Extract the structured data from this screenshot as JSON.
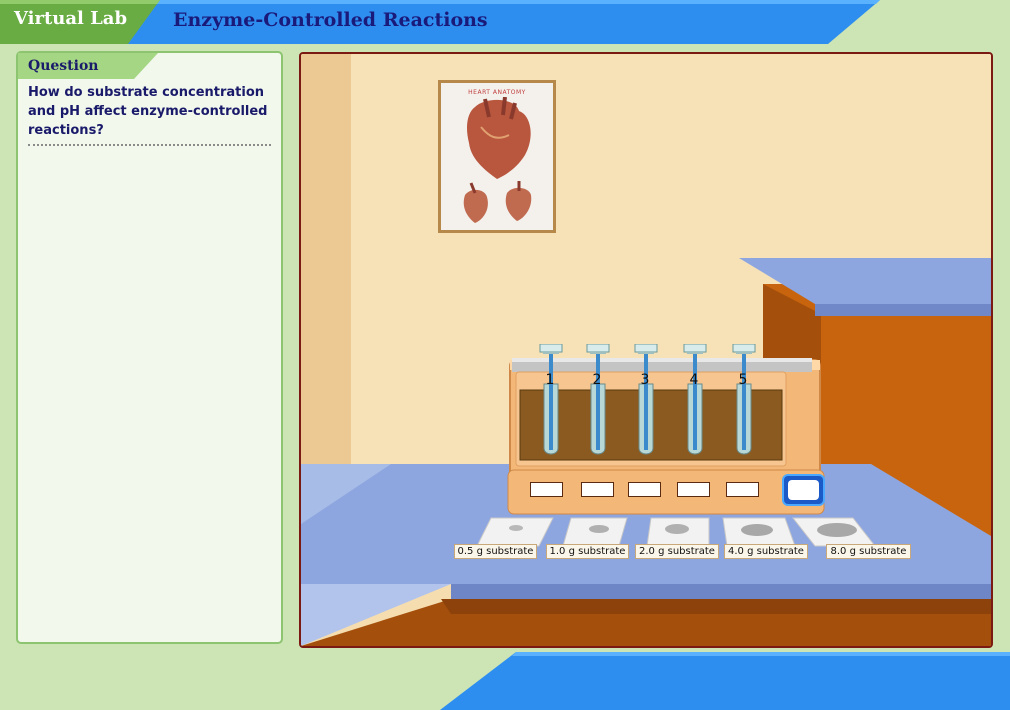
{
  "header": {
    "brand": "Virtual Lab",
    "title": "Enzyme-Controlled Reactions"
  },
  "question": {
    "label": "Question",
    "text": "How do substrate concentration and pH affect enzyme-controlled reactions?"
  },
  "poster": {
    "title": "HEART ANATOMY"
  },
  "tubes": [
    "1",
    "2",
    "3",
    "4",
    "5"
  ],
  "substrates": [
    "0.5 g substrate",
    "1.0 g substrate",
    "2.0 g substrate",
    "4.0 g substrate",
    "8.0 g substrate"
  ],
  "colors": {
    "header_blue": "#2e8ef0",
    "brand_green": "#6aac44",
    "title_navy": "#1a1a7a",
    "panel_border": "#8cc46f",
    "wall": "#f5ddb0",
    "bench_top": "#8ea6e0",
    "cabinet": "#c8640e"
  }
}
